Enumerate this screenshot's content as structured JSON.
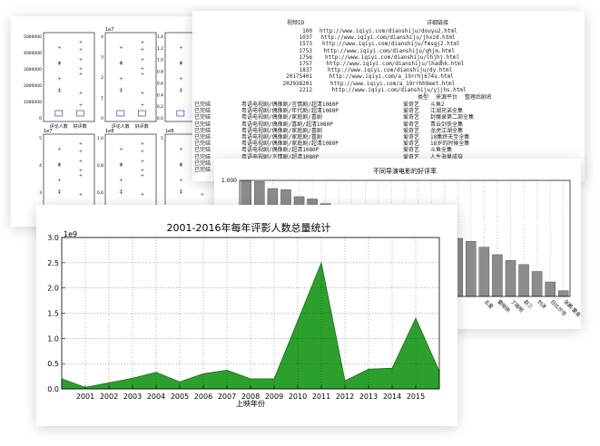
{
  "main_chart": {
    "title": "2001-2016年每年评影人数总量统计",
    "xlabel": "上映年份",
    "exponent": "1e9",
    "fill_color": "#2ca02c",
    "line_color": "#1e6b1e"
  },
  "chart_data": [
    {
      "type": "area",
      "title": "2001-2016年每年评影人数总量统计",
      "xlabel": "上映年份",
      "ylabel": "",
      "x": [
        2000,
        2001,
        2002,
        2003,
        2004,
        2005,
        2006,
        2007,
        2008,
        2009,
        2010,
        2011,
        2012,
        2013,
        2014,
        2015,
        2016
      ],
      "x_ticks": [
        "2001",
        "2002",
        "2003",
        "2004",
        "2005",
        "2006",
        "2007",
        "2008",
        "2009",
        "2010",
        "2011",
        "2012",
        "2013",
        "2014",
        "2015"
      ],
      "values": [
        0.2,
        0.03,
        0.12,
        0.21,
        0.33,
        0.14,
        0.3,
        0.37,
        0.2,
        0.2,
        1.35,
        2.5,
        0.16,
        0.39,
        0.41,
        1.4,
        0.35
      ],
      "y_ticks": [
        "0.0",
        "0.5",
        "1.0",
        "1.5",
        "2.0",
        "2.5",
        "3.0"
      ],
      "ylim": [
        0,
        3.0
      ],
      "y_multiplier": "1e9",
      "grid": true
    },
    {
      "type": "bar",
      "title": "不同导演电影的好评率",
      "y_ticks": [
        "1.000",
        "0.995"
      ],
      "values": [
        0.9999,
        0.9998,
        0.9986,
        0.9984,
        0.9972,
        0.9968,
        0.996,
        0.9955,
        0.995,
        0.9948,
        0.9946,
        0.994,
        0.993,
        0.9925,
        0.9915,
        0.9905,
        0.99,
        0.9895,
        0.9885,
        0.9872,
        0.9862,
        0.9855,
        0.9843,
        0.9825,
        0.981
      ],
      "ylim": [
        0.98,
        1.0
      ],
      "bar_color": "#8c8c8c",
      "visible_category_labels": [
        "五星",
        "雷晓刚",
        "丁晓明",
        "赵三",
        "刘洋",
        "日比沙也",
        "张鹏·雷金"
      ]
    },
    {
      "type": "scatter",
      "title": "",
      "panels": [
        {
          "exponent": "",
          "y_ticks": [
            "5000000",
            "4000000",
            "3000000",
            "2000000",
            "1000000",
            "0"
          ],
          "x_labels": [
            "评论人数",
            "好评数"
          ]
        },
        {
          "exponent": "1e7",
          "y_ticks": [
            "4",
            "3",
            "2",
            "1",
            "0"
          ],
          "x_labels": [
            "评论人数",
            "好评数"
          ]
        },
        {
          "exponent": "",
          "y_ticks": [
            "1.4",
            "1.2",
            "1.0",
            "0.8",
            "0.6",
            "0.4",
            "0.2",
            "0.0"
          ],
          "x_labels": [
            "",
            ""
          ]
        },
        {
          "exponent": "",
          "y_ticks": [
            "3",
            "2",
            "1",
            "0"
          ],
          "x_labels": [
            "",
            ""
          ]
        },
        {
          "exponent": "1e7",
          "y_ticks": [
            "5",
            "4",
            "3",
            "2"
          ],
          "x_labels": []
        },
        {
          "exponent": "1e8",
          "y_ticks": [
            "1.0",
            "0.8",
            "0.6",
            "0.4"
          ],
          "x_labels": []
        },
        {
          "exponent": "1e8",
          "y_ticks": [
            "5"
          ],
          "x_labels": []
        },
        {
          "exponent": "1e7",
          "y_ticks": [
            "6"
          ],
          "x_labels": []
        }
      ]
    }
  ],
  "text_listing": {
    "header": [
      "视频ID",
      "详细链接"
    ],
    "rows": [
      [
        "100",
        "http://www.iqiyi.com/dianshiju/douyu2.html"
      ],
      [
        "1037",
        "http://www.iqiyi.com/dianshiju/jhxzd.html"
      ],
      [
        "1573",
        "http://www.iqiyi.com/dianshiju/fmsgj2.html"
      ],
      [
        "1753",
        "http://www.iqiyi.com/dianshiju/qhjm.html"
      ],
      [
        "1756",
        "http://www.iqiyi.com/dianshiju/lhjhj.html"
      ],
      [
        "1757",
        "http://www.iqiyi.com/dianshiju/lhadhk.html"
      ],
      [
        "1837",
        "http://www.iqiyi.com/dianshiju/dy.html"
      ],
      [
        "20175401",
        "http://www.iqiyi.com/a_19rrhj674s.html"
      ],
      [
        "202938201",
        "http://www.iqiyi.com/a_19rrhh9eet.html"
      ],
      [
        "2212",
        "http://www.iqiyi.com/dianshiju/yjjhs.html"
      ]
    ],
    "header2": [
      "类型",
      "来源平台",
      "整理后剧名"
    ],
    "rows2": [
      [
        "已完结",
        "粤语电视剧/偶像剧/言情剧/超清1080P",
        "爱奇艺",
        "斗鱼2"
      ],
      [
        "已完结",
        "粤语电视剧/偶像剧/年代剧/超清1080P",
        "爱奇艺",
        "江湖兄弟全集"
      ],
      [
        "已完结",
        "粤语电视剧/偶像剧/家庭剧/喜剧",
        "爱奇艺",
        "封魔录第二部全集"
      ],
      [
        "已完结",
        "粤语电视剧/偶像剧/喜剧/超清1080P",
        "爱奇艺",
        "青云剑侠全集"
      ],
      [
        "已完结",
        "粤语电视剧/偶像剧/家庭剧/喜剧",
        "爱奇艺",
        "龙虎江湖全集"
      ],
      [
        "已完结",
        "粤语电视剧/偶像剧/家庭剧/喜剧",
        "爱奇艺",
        "18集终天至全集"
      ],
      [
        "已完结",
        "粤语电视剧/偶像剧/家庭剧/超清1080P",
        "爱奇艺",
        "18岁的时候全集"
      ],
      [
        "已完结",
        "粤语电视剧/偶像剧/超清1080P",
        "爱奇艺",
        "斗鱼全集"
      ],
      [
        "已完结",
        "粤语电视剧/言情剧/超清1080P",
        "爱奇艺",
        "人生海量成倍"
      ],
      [
        "已完结",
        "粤语电视剧/偶像剧/剧情/超清1080P",
        "爱奇艺",
        "大阳的后裔"
      ],
      [
        "已完结",
        "粤语电视剧/偶像剧/剧情/超清1080P",
        "爱奇艺",
        "文艺城花老全集"
      ]
    ]
  }
}
